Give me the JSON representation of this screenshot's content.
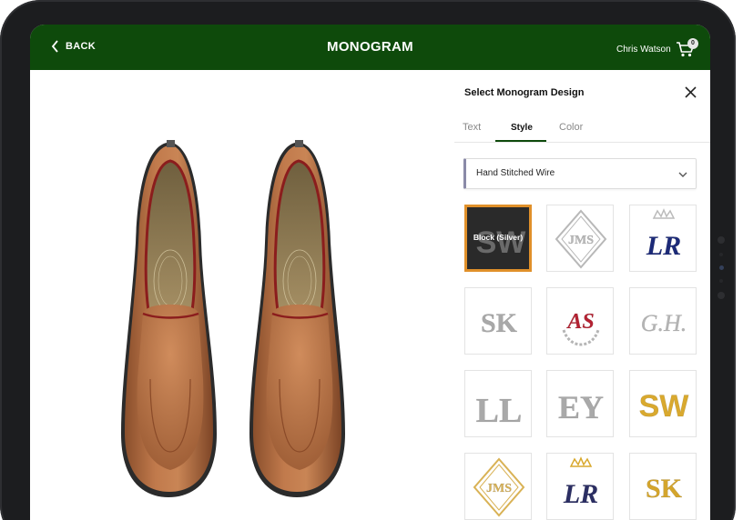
{
  "header": {
    "back_label": "BACK",
    "title": "MONOGRAM",
    "user_name": "Chris Watson",
    "cart_count": "0",
    "bg_color": "#0e4a0b"
  },
  "panel": {
    "title": "Select Monogram Design",
    "tabs": [
      {
        "label": "Text",
        "active": false
      },
      {
        "label": "Style",
        "active": true
      },
      {
        "label": "Color",
        "active": false
      }
    ],
    "select": {
      "value": "Hand Stitched Wire"
    },
    "designs": [
      {
        "name": "block-silver",
        "label": "Block (Silver)",
        "selected": true,
        "glyph": "SW",
        "color": "#9a9a9a"
      },
      {
        "name": "diamond-silver",
        "glyph": "JMS",
        "color": "#b8b8b8"
      },
      {
        "name": "crown-navy",
        "glyph": "LR",
        "color": "#1c2a78"
      },
      {
        "name": "interlocked-silver",
        "glyph": "SK",
        "color": "#a9a9a9"
      },
      {
        "name": "wreath-red",
        "glyph": "AS",
        "color": "#b52232"
      },
      {
        "name": "script-silver",
        "glyph": "G.H.",
        "color": "#b5b5b5"
      },
      {
        "name": "tall-silver",
        "glyph": "LL",
        "color": "#a9a9a9"
      },
      {
        "name": "serif-silver",
        "glyph": "EY",
        "color": "#a9a9a9"
      },
      {
        "name": "block-gold",
        "glyph": "SW",
        "color": "#d9a92e"
      },
      {
        "name": "diamond-gold",
        "glyph": "JMS",
        "color": "#d9b255"
      },
      {
        "name": "crown-navy-gold",
        "glyph": "LR",
        "color": "#2b2e63"
      },
      {
        "name": "interlocked-gold",
        "glyph": "SK",
        "color": "#d4a52c"
      }
    ]
  }
}
